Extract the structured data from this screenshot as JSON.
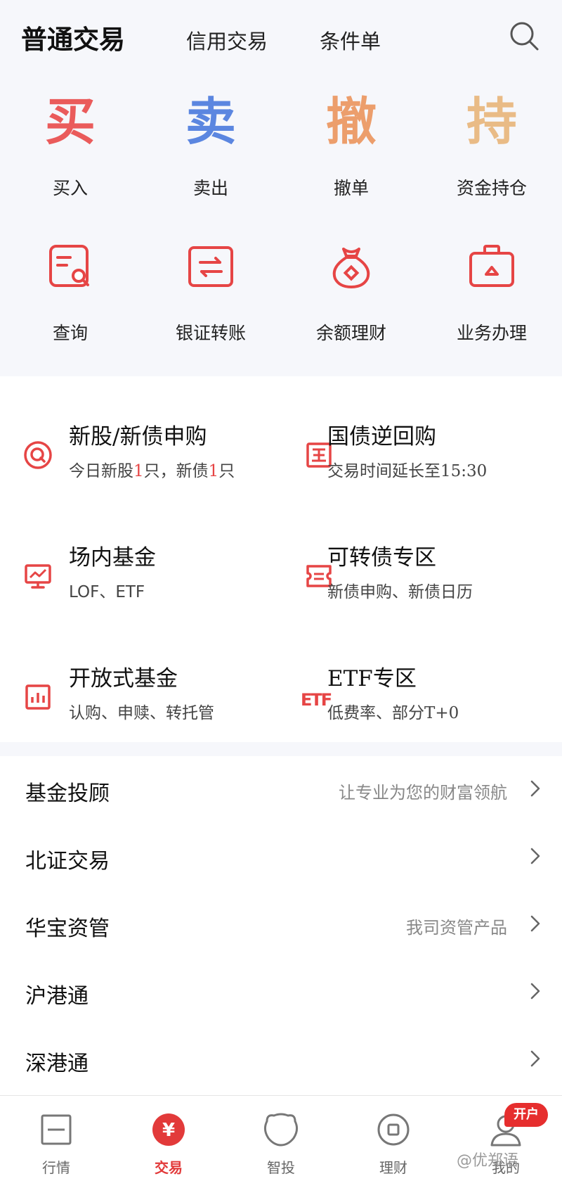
{
  "header": {
    "tabs": [
      "普通交易",
      "信用交易",
      "条件单"
    ],
    "search_icon": "search-icon"
  },
  "quick_actions": [
    {
      "glyph": "买",
      "label": "买入",
      "color": "#ea5b5b"
    },
    {
      "glyph": "卖",
      "label": "卖出",
      "color": "#5b86e0"
    },
    {
      "glyph": "撤",
      "label": "撤单",
      "color": "#ec9e6c"
    },
    {
      "glyph": "持",
      "label": "资金持仓",
      "color": "#e9bb86"
    }
  ],
  "services": [
    {
      "label": "查询",
      "icon": "query-icon"
    },
    {
      "label": "银证转账",
      "icon": "transfer-icon"
    },
    {
      "label": "余额理财",
      "icon": "money-bag-icon"
    },
    {
      "label": "业务办理",
      "icon": "briefcase-icon"
    }
  ],
  "grid": [
    {
      "title": "新股/新债申购",
      "sub_parts": [
        "今日新股",
        "1",
        "只，新债",
        "1",
        "只"
      ],
      "icon": "ipo-icon"
    },
    {
      "title": "国债逆回购",
      "sub": "交易时间延长至15:30",
      "icon": "treasury-icon"
    },
    {
      "title": "场内基金",
      "sub": "LOF、ETF",
      "icon": "chart-monitor-icon"
    },
    {
      "title": "可转债专区",
      "sub": "新债申购、新债日历",
      "icon": "convertible-bond-icon"
    },
    {
      "title": "开放式基金",
      "sub": "认购、申赎、转托管",
      "icon": "bar-chart-icon"
    },
    {
      "title": "ETF专区",
      "sub": "低费率、部分T+0",
      "icon": "etf-icon"
    }
  ],
  "list": [
    {
      "label": "基金投顾",
      "desc": "让专业为您的财富领航"
    },
    {
      "label": "北证交易",
      "desc": ""
    },
    {
      "label": "华宝资管",
      "desc": "我司资管产品"
    },
    {
      "label": "沪港通",
      "desc": ""
    },
    {
      "label": "深港通",
      "desc": ""
    }
  ],
  "bottom_nav": [
    {
      "label": "行情",
      "icon": "market-icon",
      "active": false
    },
    {
      "label": "交易",
      "icon": "yuan-icon",
      "active": true
    },
    {
      "label": "智投",
      "icon": "smart-invest-icon",
      "active": false
    },
    {
      "label": "理财",
      "icon": "wealth-icon",
      "active": false
    },
    {
      "label": "我的",
      "icon": "user-icon",
      "active": false
    }
  ],
  "badge": "开户",
  "watermark": "@优郑语",
  "colors": {
    "accent": "#e64545",
    "background": "#f6f7fb"
  }
}
